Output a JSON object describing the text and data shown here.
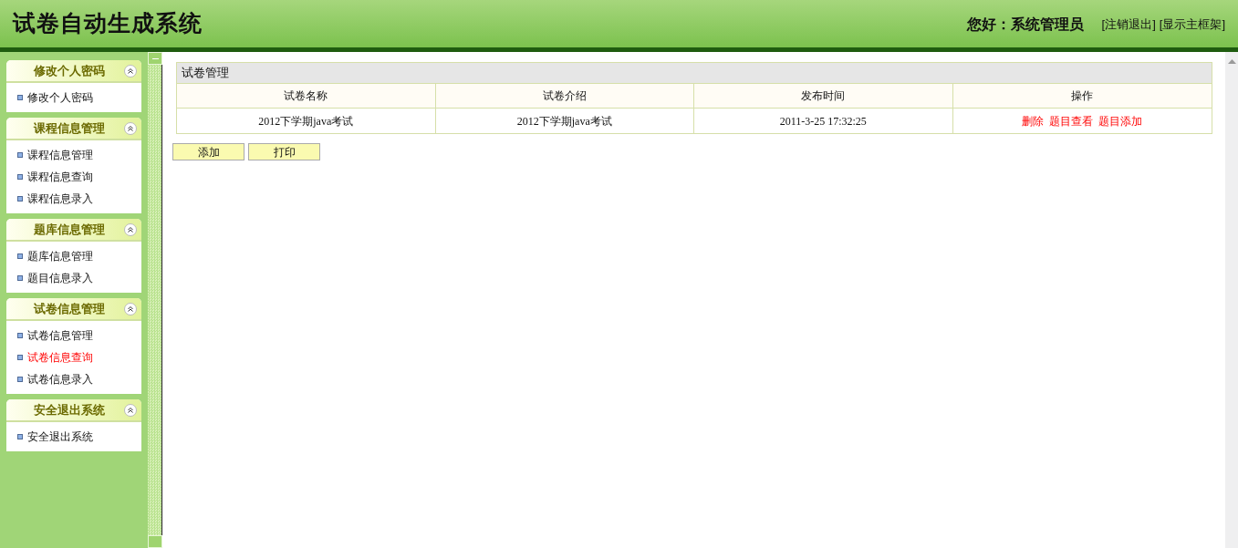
{
  "header": {
    "title": "试卷自动生成系统",
    "greeting": "您好：系统管理员",
    "links": [
      "[注销退出]",
      "[显示主框架]"
    ]
  },
  "sidebar": [
    {
      "title": "修改个人密码",
      "items": [
        {
          "label": "修改个人密码",
          "hovered": false
        }
      ]
    },
    {
      "title": "课程信息管理",
      "items": [
        {
          "label": "课程信息管理",
          "hovered": false
        },
        {
          "label": "课程信息查询",
          "hovered": false
        },
        {
          "label": "课程信息录入",
          "hovered": false
        }
      ]
    },
    {
      "title": "题库信息管理",
      "items": [
        {
          "label": "题库信息管理",
          "hovered": false
        },
        {
          "label": "题目信息录入",
          "hovered": false
        }
      ]
    },
    {
      "title": "试卷信息管理",
      "items": [
        {
          "label": "试卷信息管理",
          "hovered": false
        },
        {
          "label": "试卷信息查询",
          "hovered": true
        },
        {
          "label": "试卷信息录入",
          "hovered": false
        }
      ]
    },
    {
      "title": "安全退出系统",
      "items": [
        {
          "label": "安全退出系统",
          "hovered": false
        }
      ]
    }
  ],
  "table": {
    "title": "试卷管理",
    "columns": [
      "试卷名称",
      "试卷介绍",
      "发布时间",
      "操作"
    ],
    "rows": [
      {
        "cells": [
          "2012下学期java考试",
          "2012下学期java考试",
          "2011-3-25 17:32:25"
        ],
        "actions": [
          "删除",
          "题目查看",
          "题目添加"
        ]
      }
    ]
  },
  "buttons": [
    "添加",
    "打印"
  ]
}
